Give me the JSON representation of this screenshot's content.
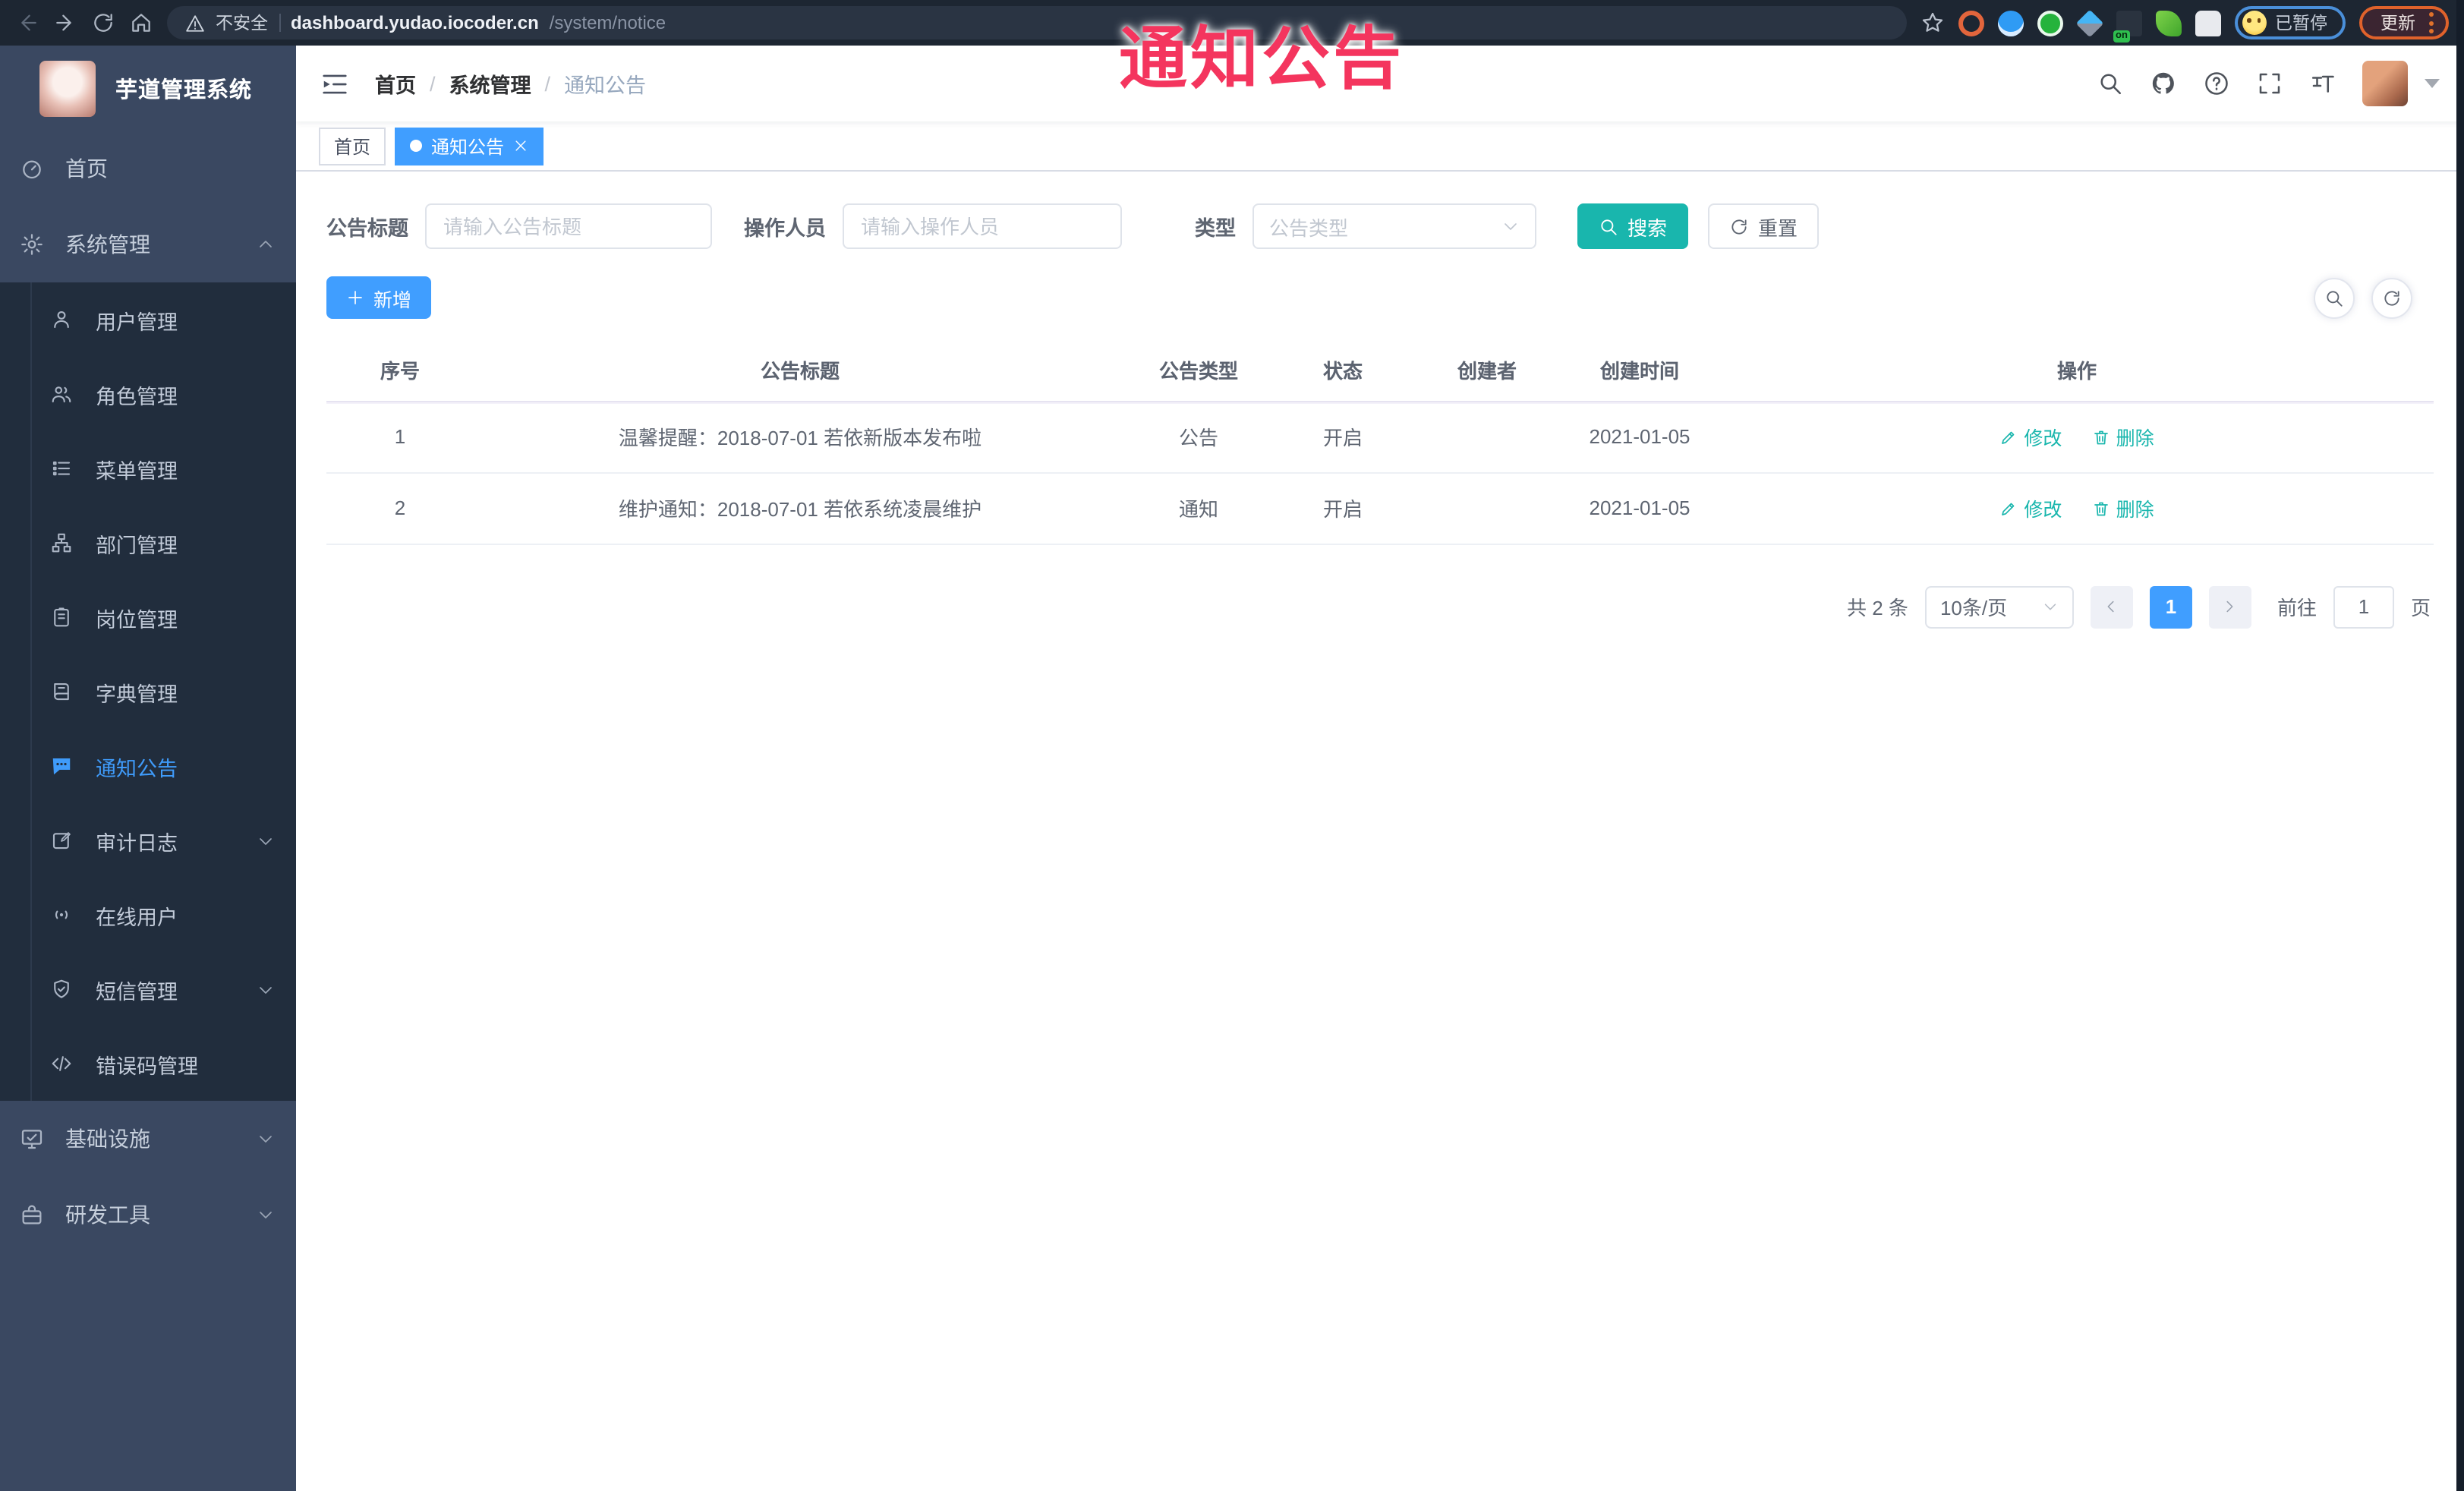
{
  "browser": {
    "security_label": "不安全",
    "url_host": "dashboard.yudao.iocoder.cn",
    "url_path": "/system/notice",
    "extension_on_badge": "on",
    "paused_badge": "已暂停",
    "update_label": "更新"
  },
  "overlay": {
    "title": "通知公告"
  },
  "sidebar": {
    "app_title": "芋道管理系统",
    "items": [
      {
        "label": "首页"
      },
      {
        "label": "系统管理",
        "expanded": true,
        "children": [
          {
            "label": "用户管理"
          },
          {
            "label": "角色管理"
          },
          {
            "label": "菜单管理"
          },
          {
            "label": "部门管理"
          },
          {
            "label": "岗位管理"
          },
          {
            "label": "字典管理"
          },
          {
            "label": "通知公告",
            "active": true
          },
          {
            "label": "审计日志"
          },
          {
            "label": "在线用户"
          },
          {
            "label": "短信管理"
          },
          {
            "label": "错误码管理"
          }
        ]
      },
      {
        "label": "基础设施"
      },
      {
        "label": "研发工具"
      }
    ]
  },
  "header": {
    "breadcrumb": [
      "首页",
      "系统管理",
      "通知公告"
    ],
    "separator": "/"
  },
  "tabs": [
    {
      "label": "首页",
      "active": false
    },
    {
      "label": "通知公告",
      "active": true
    }
  ],
  "filters": {
    "title_label": "公告标题",
    "title_placeholder": "请输入公告标题",
    "operator_label": "操作人员",
    "operator_placeholder": "请输入操作人员",
    "type_label": "类型",
    "type_placeholder": "公告类型",
    "search_label": "搜索",
    "reset_label": "重置"
  },
  "toolbar": {
    "add_label": "新增"
  },
  "table": {
    "columns": [
      "序号",
      "公告标题",
      "公告类型",
      "状态",
      "创建者",
      "创建时间",
      "操作"
    ],
    "rows": [
      {
        "index": "1",
        "title": "温馨提醒：2018-07-01 若依新版本发布啦",
        "type": "公告",
        "status": "开启",
        "creator": "",
        "create_time": "2021-01-05"
      },
      {
        "index": "2",
        "title": "维护通知：2018-07-01 若依系统凌晨维护",
        "type": "通知",
        "status": "开启",
        "creator": "",
        "create_time": "2021-01-05"
      }
    ],
    "edit_label": "修改",
    "delete_label": "删除"
  },
  "pagination": {
    "total_text": "共 2 条",
    "page_size": "10条/页",
    "current_page": "1",
    "goto_label": "前往",
    "goto_value": "1",
    "page_unit": "页"
  },
  "colors": {
    "primary_blue": "#409eff",
    "accent_teal": "#19b6ad",
    "overlay_red": "#f4355e",
    "sidebar_bg": "#3a4861",
    "submenu_bg": "#212d3d"
  }
}
